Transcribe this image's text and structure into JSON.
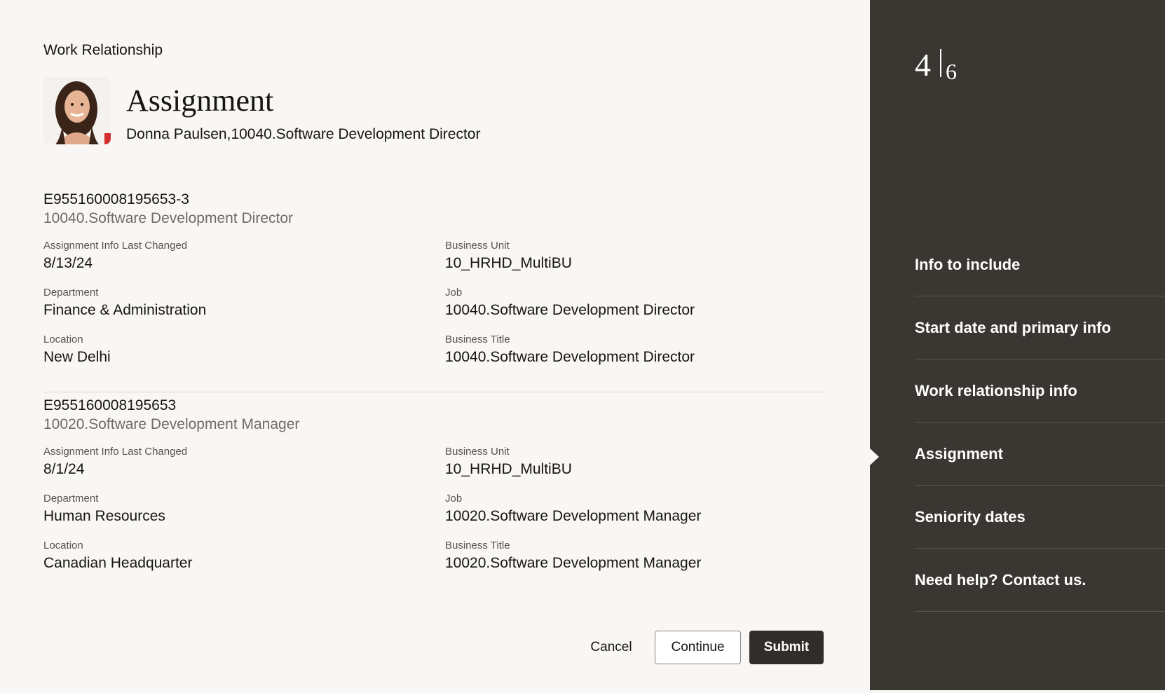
{
  "breadcrumb": "Work Relationship",
  "page_title": "Assignment",
  "subtitle": "Donna Paulsen,10040.Software Development Director",
  "avatar_icon": "person-photo-icon",
  "assignments": [
    {
      "number": "E955160008195653-3",
      "job_line": "10040.Software Development Director",
      "fields": {
        "last_changed_label": "Assignment Info Last Changed",
        "last_changed": "8/13/24",
        "business_unit_label": "Business Unit",
        "business_unit": "10_HRHD_MultiBU",
        "department_label": "Department",
        "department": "Finance & Administration",
        "job_label": "Job",
        "job": "10040.Software Development Director",
        "location_label": "Location",
        "location": "New Delhi",
        "business_title_label": "Business Title",
        "business_title": "10040.Software Development Director"
      }
    },
    {
      "number": "E955160008195653",
      "job_line": "10020.Software Development Manager",
      "fields": {
        "last_changed_label": "Assignment Info Last Changed",
        "last_changed": "8/1/24",
        "business_unit_label": "Business Unit",
        "business_unit": "10_HRHD_MultiBU",
        "department_label": "Department",
        "department": "Human Resources",
        "job_label": "Job",
        "job": "10020.Software Development Manager",
        "location_label": "Location",
        "location": "Canadian Headquarter",
        "business_title_label": "Business Title",
        "business_title": "10020.Software Development Manager"
      }
    }
  ],
  "buttons": {
    "cancel": "Cancel",
    "continue": "Continue",
    "submit": "Submit"
  },
  "progress": {
    "current": "4",
    "total": "6"
  },
  "steps": [
    {
      "label": "Info to include"
    },
    {
      "label": "Start date and primary info"
    },
    {
      "label": "Work relationship info"
    },
    {
      "label": "Assignment",
      "current": true
    },
    {
      "label": "Seniority dates"
    },
    {
      "label": "Need help? Contact us."
    }
  ],
  "colors": {
    "sidebar": "#3a3632",
    "primary_button": "#312d2a",
    "page_bg": "#f9f7f5"
  }
}
